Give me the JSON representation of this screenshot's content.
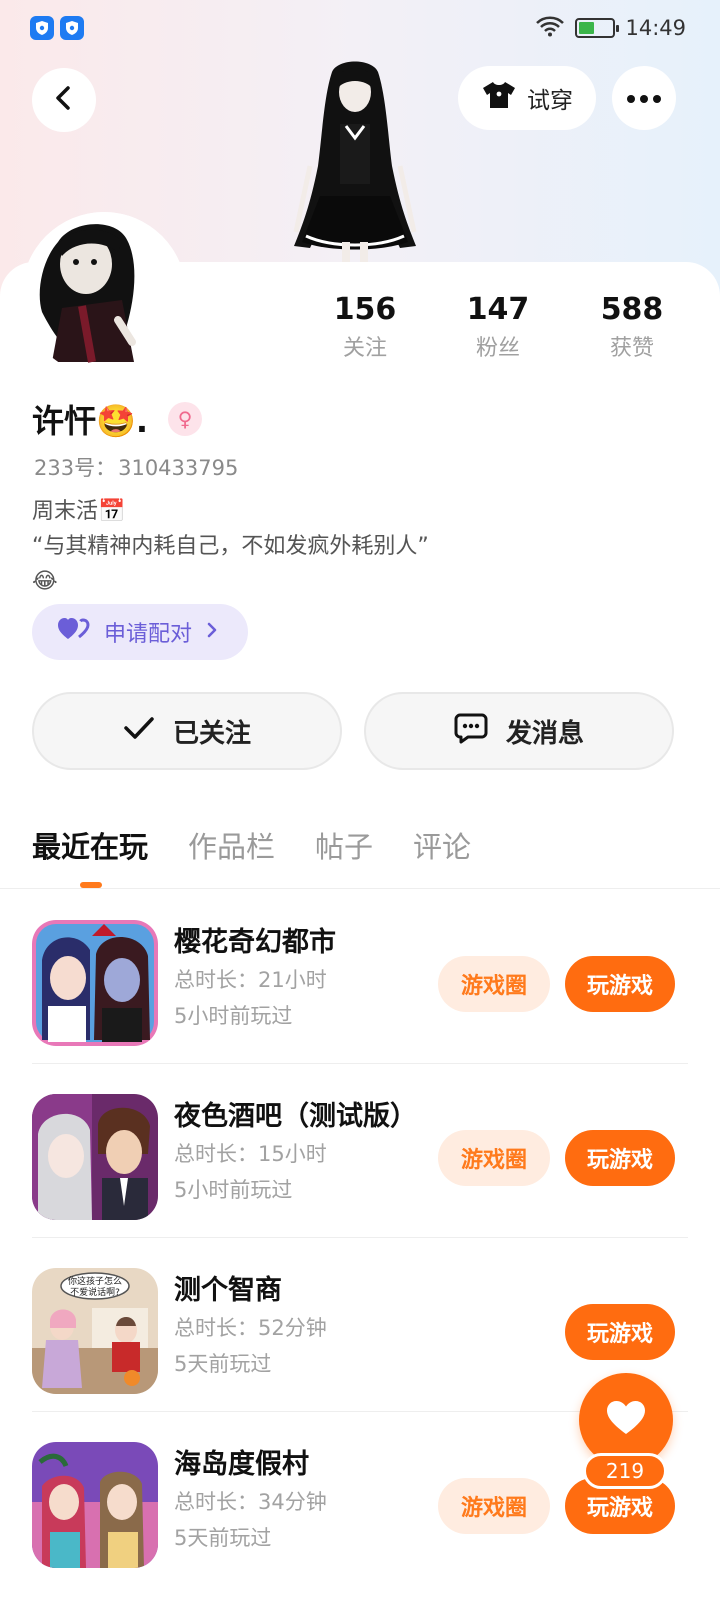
{
  "status_bar": {
    "time": "14:49",
    "battery_level": 0.45,
    "wifi_icon": "wifi-icon",
    "notification_icons": [
      "shield-icon",
      "shield-icon"
    ]
  },
  "header": {
    "back_icon": "back-arrow-icon",
    "try_on_label": "试穿",
    "try_on_icon": "tshirt-icon",
    "more_icon": "more-dots-icon"
  },
  "profile": {
    "stats": [
      {
        "value": "156",
        "label": "关注"
      },
      {
        "value": "147",
        "label": "粉丝"
      },
      {
        "value": "588",
        "label": "获赞"
      }
    ],
    "username": "许忓🤩.",
    "gender_icon": "female-icon",
    "uid_label": "233号：",
    "uid_value": "310433795",
    "bio_line1": "周末活📅",
    "bio_line2": "“与其精神内耗自己，不如发疯外耗别人”",
    "bio_line3": "😂",
    "pair_label": "申请配对"
  },
  "actions": {
    "follow_label": "已关注",
    "message_label": "发消息"
  },
  "tabs": [
    {
      "label": "最近在玩",
      "active": true
    },
    {
      "label": "作品栏",
      "active": false
    },
    {
      "label": "帖子",
      "active": false
    },
    {
      "label": "评论",
      "active": false
    }
  ],
  "games": [
    {
      "name": "樱花奇幻都市",
      "time": "总时长：21小时",
      "ago": "5小时前玩过",
      "circle_label": "游戏圈",
      "play_label": "玩游戏"
    },
    {
      "name": "夜色酒吧（测试版）",
      "time": "总时长：15小时",
      "ago": "5小时前玩过",
      "circle_label": "游戏圈",
      "play_label": "玩游戏"
    },
    {
      "name": "测个智商",
      "time": "总时长：52分钟",
      "ago": "5天前玩过",
      "play_label": "玩游戏",
      "bubble_text_1": "你这孩子怎么",
      "bubble_text_2": "不爱说话啊?"
    },
    {
      "name": "海岛度假村",
      "time": "总时长：34分钟",
      "ago": "5天前玩过",
      "circle_label": "游戏圈",
      "play_label": "玩游戏"
    }
  ],
  "like_fab": {
    "icon": "heart-icon",
    "count": "219"
  },
  "colors": {
    "accent": "#ff6c10",
    "accent_light": "#ffece0",
    "pair_bg": "#ece9fb",
    "pair_text": "#6b5ed8"
  }
}
